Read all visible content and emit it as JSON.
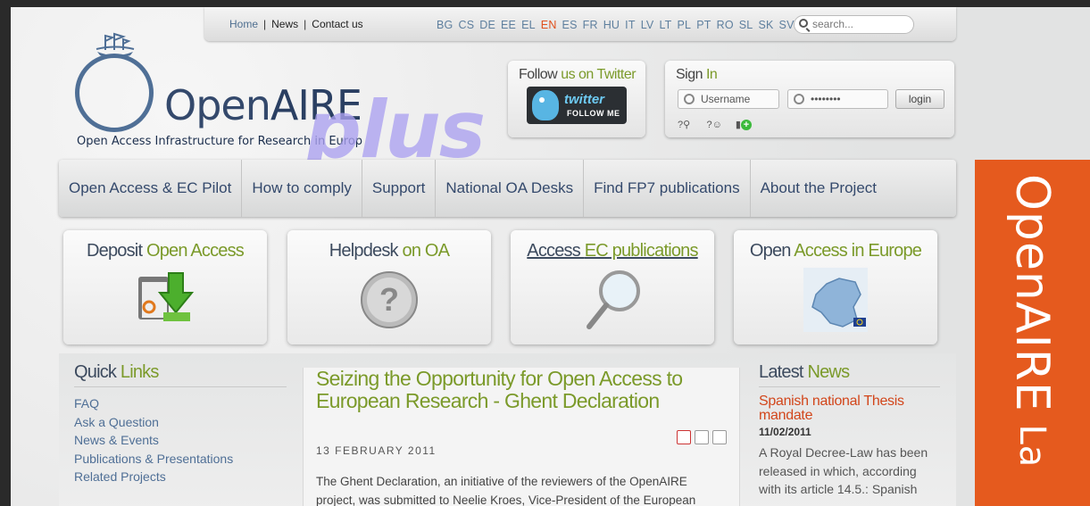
{
  "topbar": {
    "links": [
      "Home",
      "News",
      "Contact us"
    ],
    "languages": [
      "BG",
      "CS",
      "DE",
      "EE",
      "EL",
      "EN",
      "ES",
      "FR",
      "HU",
      "IT",
      "LV",
      "LT",
      "PL",
      "PT",
      "RO",
      "SL",
      "SK",
      "SV"
    ],
    "active_language": "EN",
    "search_placeholder": "search..."
  },
  "logo": {
    "name_open": "Open",
    "name_aire": "AIRE",
    "tagline": "Open Access Infrastructure for Research in Europ",
    "plus": "plus"
  },
  "twitter": {
    "title_prefix": "Follow ",
    "title_suffix": "us on Twitter",
    "button_logo": "twitter",
    "button_text": "FOLLOW ME"
  },
  "signin": {
    "title_prefix": "Sign ",
    "title_suffix": "In",
    "username_placeholder": "Username",
    "password_value": "••••••••",
    "login_label": "login"
  },
  "nav": {
    "items": [
      "Open Access & EC Pilot",
      "How to comply",
      "Support",
      "National OA Desks",
      "Find FP7 publications",
      "About the Project"
    ]
  },
  "tiles": [
    {
      "title_a": "Deposit ",
      "title_b": "Open Access",
      "icon": "folder-download-icon"
    },
    {
      "title_a": "Helpdesk ",
      "title_b": "on OA",
      "icon": "question-icon"
    },
    {
      "title_a": "Access ",
      "title_b": "EC publications",
      "icon": "magnifier-icon"
    },
    {
      "title_a": "Open ",
      "title_b": "Access in Europe",
      "icon": "europe-map-icon"
    }
  ],
  "quick_links": {
    "title_a": "Quick ",
    "title_b": "Links",
    "items": [
      "FAQ",
      "Ask a Question",
      "News & Events",
      "Publications & Presentations",
      "Related Projects"
    ]
  },
  "article": {
    "headline": "Seizing the Opportunity for Open Access to European Research - Ghent Declaration",
    "date": "13 FEBRUARY 2011",
    "body": "The Ghent Declaration, an initiative of the reviewers of the OpenAIRE project, was submitted to Neelie Kroes, Vice-President of the European"
  },
  "latest_news": {
    "title_a": "Latest ",
    "title_b": "News",
    "headline": "Spanish national Thesis mandate",
    "date": "11/02/2011",
    "body": "A Royal Decree-Law has been released in which, according with its article 14.5.: Spanish"
  },
  "banner": {
    "text": "OpenAIRE",
    "text_small": " La"
  },
  "colors": {
    "accent_green": "#7b9a2a",
    "navy": "#34496c",
    "banner_orange": "#e55a1e",
    "news_red": "#d2461b"
  }
}
